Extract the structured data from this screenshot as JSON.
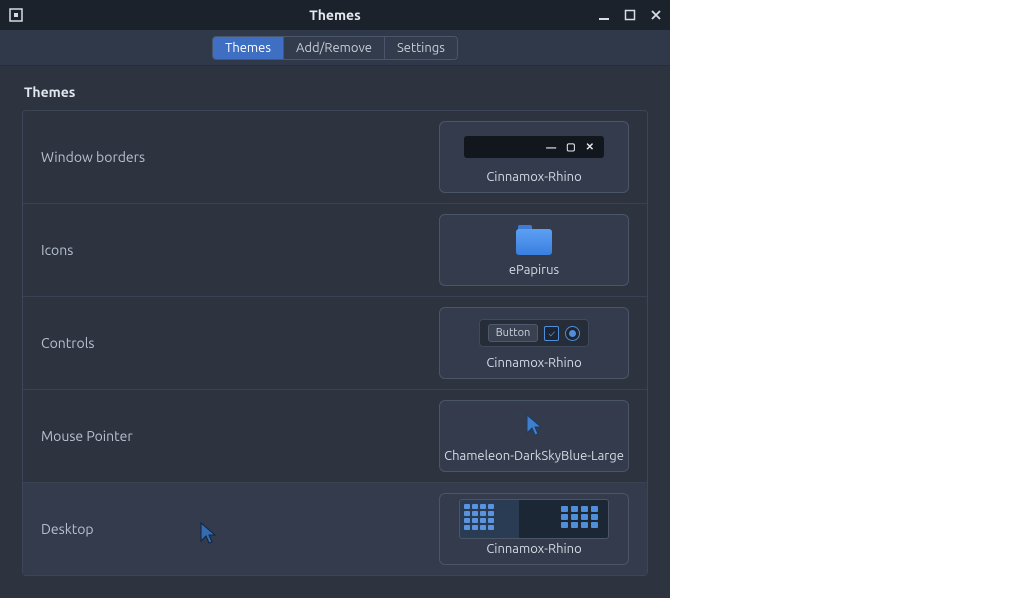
{
  "window": {
    "title": "Themes"
  },
  "tabs": {
    "items": [
      "Themes",
      "Add/Remove",
      "Settings"
    ],
    "active_index": 0
  },
  "section": {
    "heading": "Themes"
  },
  "rows": {
    "window_borders": {
      "label": "Window borders",
      "value": "Cinnamox-Rhino"
    },
    "icons": {
      "label": "Icons",
      "value": "ePapirus"
    },
    "controls": {
      "label": "Controls",
      "value": "Cinnamox-Rhino",
      "button_text": "Button"
    },
    "mouse_pointer": {
      "label": "Mouse Pointer",
      "value": "Chameleon-DarkSkyBlue-Large"
    },
    "desktop": {
      "label": "Desktop",
      "value": "Cinnamox-Rhino"
    }
  }
}
